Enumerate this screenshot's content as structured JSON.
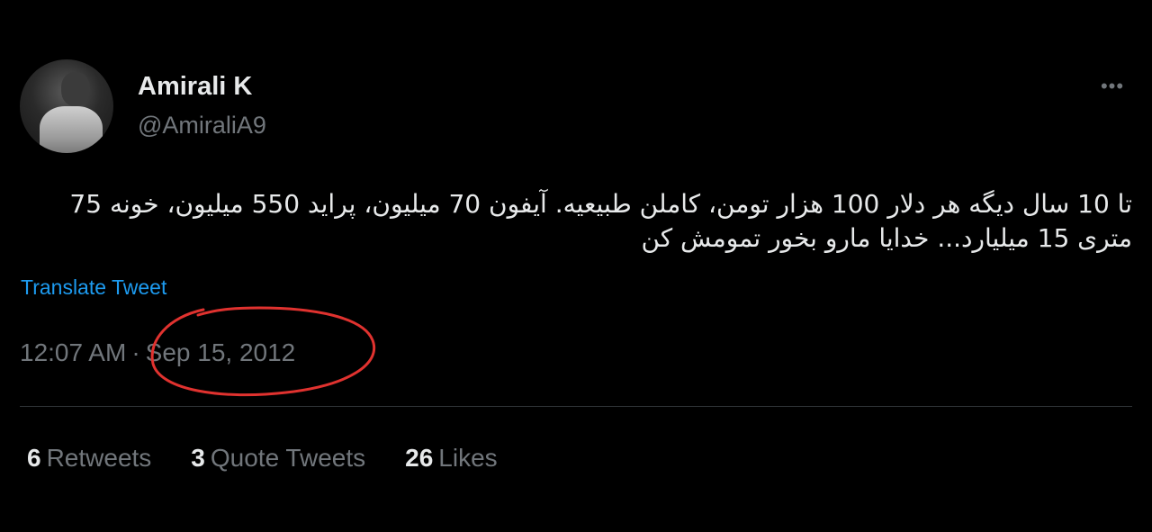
{
  "tweet": {
    "author": {
      "display_name": "Amirali K",
      "handle": "@AmiraliA9"
    },
    "more_icon": "more-horizontal-icon",
    "text": "تا 10 سال دیگه هر دلار 100 هزار تومن، کاملن طبیعیه. آیفون 70 میلیون، پراید 550 میلیون، خونه 75 متری 15 میلیارد... خدایا مارو بخور تمومش کن",
    "translate_label": "Translate Tweet",
    "time": "12:07 AM",
    "date": "Sep 15, 2012",
    "stats": {
      "retweets_count": "6",
      "retweets_label": "Retweets",
      "quotes_count": "3",
      "quotes_label": "Quote Tweets",
      "likes_count": "26",
      "likes_label": "Likes"
    }
  },
  "colors": {
    "background": "#000000",
    "text_primary": "#e7e9ea",
    "text_secondary": "#71767b",
    "link": "#1d9bf0",
    "annotation_circle": "#e0322f"
  }
}
